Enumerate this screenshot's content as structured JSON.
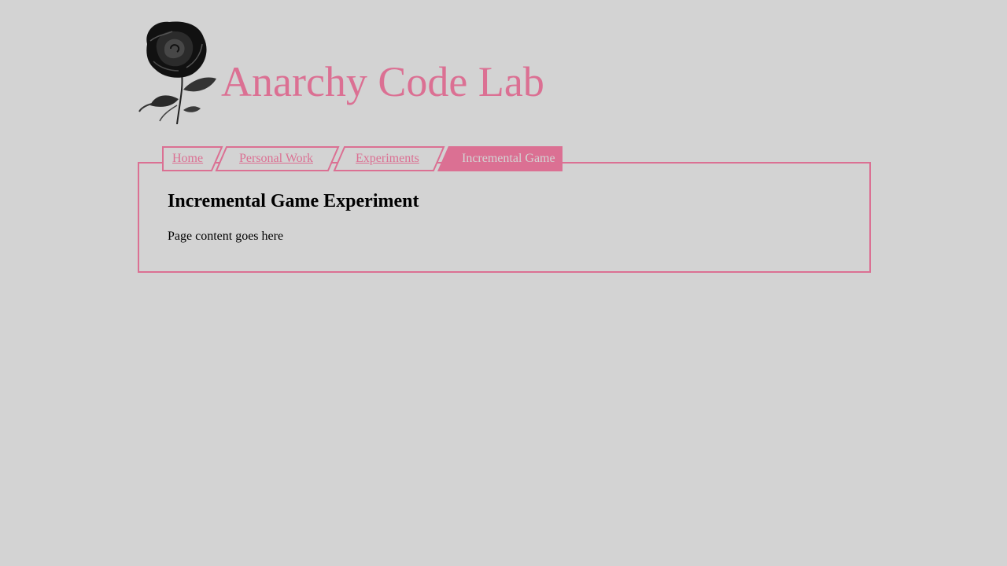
{
  "site": {
    "title": "Anarchy Code Lab",
    "logo_icon": "rose-icon",
    "accent_color": "#db7093",
    "background_color": "#d3d3d3"
  },
  "nav": {
    "tabs": [
      {
        "label": "Home",
        "active": false
      },
      {
        "label": "Personal Work",
        "active": false
      },
      {
        "label": "Experiments",
        "active": false
      },
      {
        "label": "Incremental Game",
        "active": true
      }
    ]
  },
  "main": {
    "heading": "Incremental Game Experiment",
    "body": "Page content goes here"
  }
}
